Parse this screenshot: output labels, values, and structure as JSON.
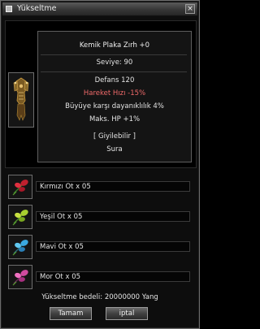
{
  "window": {
    "title": "Yükseltme",
    "close_glyph": "×"
  },
  "item": {
    "name": "Kemik Plaka Zırh +0",
    "level": "Seviye: 90",
    "defense": "Defans 120",
    "move_speed": "Hareket Hızı -15%",
    "magic_resist": "Büyüye karşı dayanıklılık 4%",
    "max_hp": "Maks. HP +1%",
    "wearable": "[ Giyilebilir ]",
    "class": "Sura",
    "icon": "bone-plate-armor-icon"
  },
  "materials": [
    {
      "label": "Kırmızı Ot x 05",
      "icon": "red-herb-icon",
      "color": "#d2263a"
    },
    {
      "label": "Yeşil Ot x 05",
      "icon": "green-herb-icon",
      "color": "#9ccc2a"
    },
    {
      "label": "Mavi Ot x 05",
      "icon": "blue-herb-icon",
      "color": "#3aa0d8"
    },
    {
      "label": "Mor Ot x 05",
      "icon": "purple-herb-icon",
      "color": "#d24aa0"
    }
  ],
  "cost": "Yükseltme bedeli: 20000000 Yang",
  "buttons": {
    "confirm": "Tamam",
    "cancel": "iptal"
  },
  "colors": {
    "penalty_text": "#f06a6a"
  }
}
